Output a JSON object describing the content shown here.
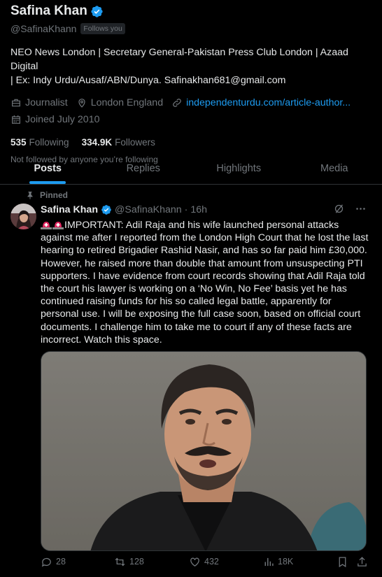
{
  "profile": {
    "name": "Safina Khan",
    "handle": "@SafinaKhann",
    "follows_you": "Follows you",
    "bio_line1": "NEO News London | Secretary General-Pakistan Press Club London | Azaad Digital",
    "bio_line2": "| Ex: Indy Urdu/Ausaf/ABN/Dunya. Safinakhan681@gmail.com",
    "profession": "Journalist",
    "location": "London  England",
    "website": "independenturdu.com/article-author...",
    "joined": "Joined July 2010",
    "following_count": "535",
    "following_label": "Following",
    "followers_count": "334.9K",
    "followers_label": "Followers",
    "not_followed": "Not followed by anyone you’re following"
  },
  "tabs": [
    {
      "label": "Posts",
      "active": true
    },
    {
      "label": "Replies",
      "active": false
    },
    {
      "label": "Highlights",
      "active": false
    },
    {
      "label": "Media",
      "active": false
    }
  ],
  "post": {
    "pinned_label": "Pinned",
    "name": "Safina Khan",
    "handle": "@SafinaKhann",
    "dot": "·",
    "time": "16h",
    "text_line1": "IMPORTANT: Adil Raja and his wife launched personal attacks against",
    "text_rest": "me after I reported from the London High Court that he lost the last hearing to retired Brigadier Rashid Nasir, and has so far paid him £30,000. However, he raised more than double that amount from unsuspecting PTI supporters. I have evidence from court records showing that Adil Raja told the court his lawyer is working on a ‘No Win, No Fee’ basis yet he has continued raising funds for his so called legal battle, apparently for personal use. I will be exposing the full case soon, based on official court documents. I challenge him to take me to court if any of these facts are incorrect. Watch this space.",
    "replies": "28",
    "reposts": "128",
    "likes": "432",
    "views": "18K"
  },
  "colors": {
    "background": "#000000",
    "text": "#e7e9ea",
    "muted": "#71767b",
    "accent": "#1d9bf0",
    "divider": "#2f3336"
  },
  "icons": [
    "verified-badge-icon",
    "briefcase-icon",
    "location-pin-icon",
    "link-icon",
    "calendar-icon",
    "pin-icon",
    "grok-icon",
    "more-icon",
    "reply-icon",
    "repost-icon",
    "like-icon",
    "views-icon",
    "bookmark-icon",
    "share-icon",
    "siren-emoji-icon"
  ]
}
